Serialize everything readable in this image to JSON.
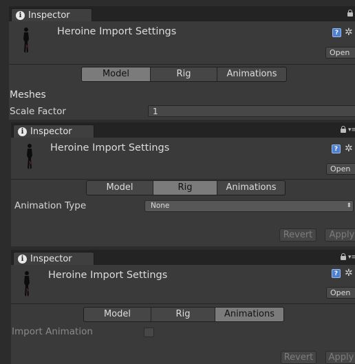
{
  "tab_label": "Inspector",
  "asset_title": "Heroine Import Settings",
  "open_label": "Open",
  "tabs": [
    "Model",
    "Rig",
    "Animations"
  ],
  "panel1": {
    "meshes_label": "Meshes",
    "scale_factor_label": "Scale Factor",
    "scale_factor_value": "1"
  },
  "panel2": {
    "animation_type_label": "Animation Type",
    "animation_type_value": "None",
    "revert_label": "Revert",
    "apply_label": "Apply"
  },
  "panel3": {
    "import_animation_label": "Import Animation",
    "revert_label": "Revert",
    "apply_label": "Apply"
  },
  "colors": {
    "active_tab": "#7b7b7b",
    "panel_bg": "#3a3a3a",
    "help_icon": "#4e7fd0"
  }
}
